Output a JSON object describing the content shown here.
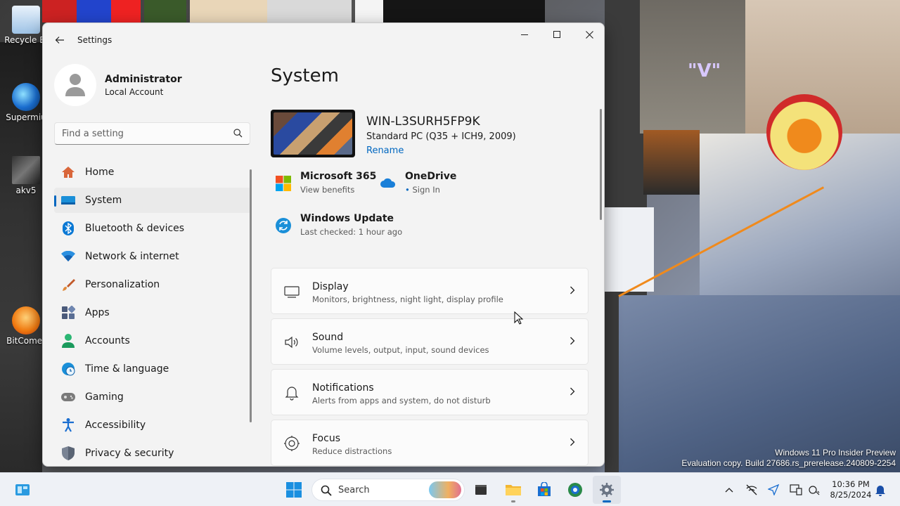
{
  "desktop": {
    "icons": [
      {
        "label": "Recycle Bi"
      },
      {
        "label": "Supermiu"
      },
      {
        "label": "akv5"
      },
      {
        "label": "BitComet"
      }
    ],
    "wallpaper_text": "\"V\"",
    "watermark": {
      "line1": "Windows 11 Pro Insider Preview",
      "line2": "Evaluation copy. Build 27686.rs_prerelease.240809-2254"
    }
  },
  "window": {
    "title": "Settings",
    "controls": {
      "minimize": "minimize-icon",
      "maximize": "maximize-icon",
      "close": "close-icon"
    }
  },
  "profile": {
    "name": "Administrator",
    "account_type": "Local Account"
  },
  "search": {
    "placeholder": "Find a setting"
  },
  "nav": {
    "items": [
      {
        "label": "Home",
        "icon": "home-icon"
      },
      {
        "label": "System",
        "icon": "system-icon",
        "active": true
      },
      {
        "label": "Bluetooth & devices",
        "icon": "bluetooth-icon"
      },
      {
        "label": "Network & internet",
        "icon": "wifi-icon"
      },
      {
        "label": "Personalization",
        "icon": "brush-icon"
      },
      {
        "label": "Apps",
        "icon": "apps-icon"
      },
      {
        "label": "Accounts",
        "icon": "accounts-icon"
      },
      {
        "label": "Time & language",
        "icon": "clock-globe-icon"
      },
      {
        "label": "Gaming",
        "icon": "gamepad-icon"
      },
      {
        "label": "Accessibility",
        "icon": "accessibility-icon"
      },
      {
        "label": "Privacy & security",
        "icon": "shield-icon"
      }
    ]
  },
  "main": {
    "title": "System",
    "device": {
      "name": "WIN-L3SURH5FP9K",
      "model": "Standard PC (Q35 + ICH9, 2009)",
      "rename": "Rename"
    },
    "quick": {
      "ms365": {
        "title": "Microsoft 365",
        "subtitle": "View benefits"
      },
      "onedrive": {
        "title": "OneDrive",
        "subtitle": "Sign In"
      },
      "update": {
        "title": "Windows Update",
        "subtitle": "Last checked: 1 hour ago"
      }
    },
    "cards": [
      {
        "title": "Display",
        "subtitle": "Monitors, brightness, night light, display profile",
        "icon": "monitor-icon"
      },
      {
        "title": "Sound",
        "subtitle": "Volume levels, output, input, sound devices",
        "icon": "speaker-icon"
      },
      {
        "title": "Notifications",
        "subtitle": "Alerts from apps and system, do not disturb",
        "icon": "bell-icon"
      },
      {
        "title": "Focus",
        "subtitle": "Reduce distractions",
        "icon": "focus-icon"
      }
    ]
  },
  "taskbar": {
    "search_label": "Search",
    "clock": {
      "time": "10:36 PM",
      "date": "8/25/2024"
    }
  },
  "colors": {
    "accent": "#0067c0",
    "window_bg": "#f3f3f3",
    "card_bg": "#fbfbfb"
  }
}
